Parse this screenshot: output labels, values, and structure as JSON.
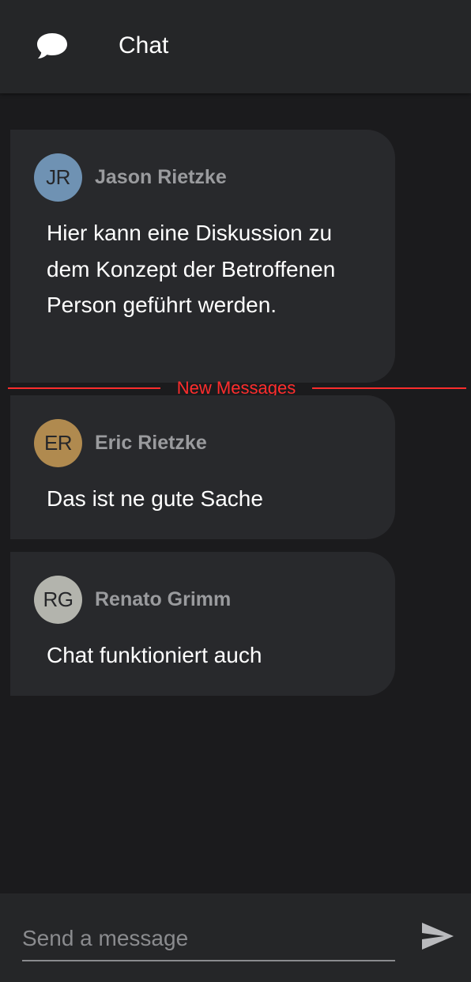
{
  "header": {
    "title": "Chat",
    "icon": "chat-bubble-icon"
  },
  "messages": [
    {
      "initials": "JR",
      "author": "Jason Rietzke",
      "avatar_color": "#6f92b3",
      "text": "Hier kann eine Diskussion zu dem Konzept der Betroffenen Person geführt werden."
    },
    {
      "initials": "ER",
      "author": "Eric Rietzke",
      "avatar_color": "#b08a4f",
      "text": "Das ist ne gute Sache"
    },
    {
      "initials": "RG",
      "author": "Renato Grimm",
      "avatar_color": "#b3b4ad",
      "text": "Chat funktioniert auch"
    }
  ],
  "divider": {
    "label": "New Messages",
    "color": "#ff2d2d"
  },
  "composer": {
    "placeholder": "Send a message",
    "value": "",
    "send_icon": "send-icon"
  }
}
